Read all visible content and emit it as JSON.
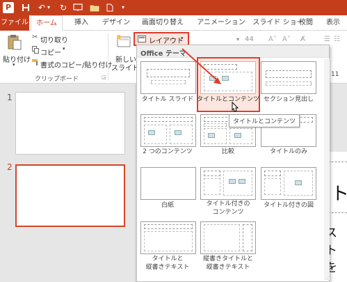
{
  "app": {
    "logo_letter": "P"
  },
  "quick_access": [
    {
      "name": "save-icon",
      "glyph": "💾"
    },
    {
      "name": "undo-icon",
      "glyph": "↶"
    },
    {
      "name": "redo-icon",
      "glyph": "↻"
    },
    {
      "name": "start-from-beginning-icon",
      "glyph": "▶"
    },
    {
      "name": "open-folder-icon",
      "glyph": "▬"
    },
    {
      "name": "new-file-icon",
      "glyph": "▯"
    },
    {
      "name": "customize-qat-icon",
      "glyph": "▾"
    }
  ],
  "tabs": {
    "file": "ファイル",
    "home": "ホーム",
    "insert": "挿入",
    "design": "デザイン",
    "transitions": "画面切り替え",
    "animations": "アニメーション",
    "slideshow": "スライド ショー",
    "review": "校閲",
    "view": "表示"
  },
  "ribbon": {
    "paste": "貼り付け",
    "cut": "切り取り",
    "copy": "コピー",
    "format_painter": "書式のコピー/貼り付け",
    "clipboard_group": "クリップボード",
    "new_slide_line1": "新しい",
    "new_slide_line2": "スライド",
    "layout_button": "レイアウト",
    "font_size": "44",
    "size_box_value": "11"
  },
  "slides_panel": {
    "slide1_number": "1",
    "slide2_number": "2"
  },
  "canvas": {
    "title_fragment": "ト",
    "body_fragment": "ストを"
  },
  "gallery": {
    "header": "Office テーマ",
    "layouts": [
      "タイトル スライド",
      "タイトルとコンテンツ",
      "セクション見出し",
      "2 つのコンテンツ",
      "比較",
      "タイトルのみ",
      "白紙",
      "タイトル付きの\nコンテンツ",
      "タイトル付きの図",
      "タイトルと\n縦書きテキスト",
      "縦書きタイトルと\n縦書きテキスト"
    ],
    "tooltip": "タイトルとコンテンツ"
  },
  "colors": {
    "brand": "#c43e1c",
    "highlight": "#e03c2c",
    "selected_slide_border": "#d24726"
  }
}
